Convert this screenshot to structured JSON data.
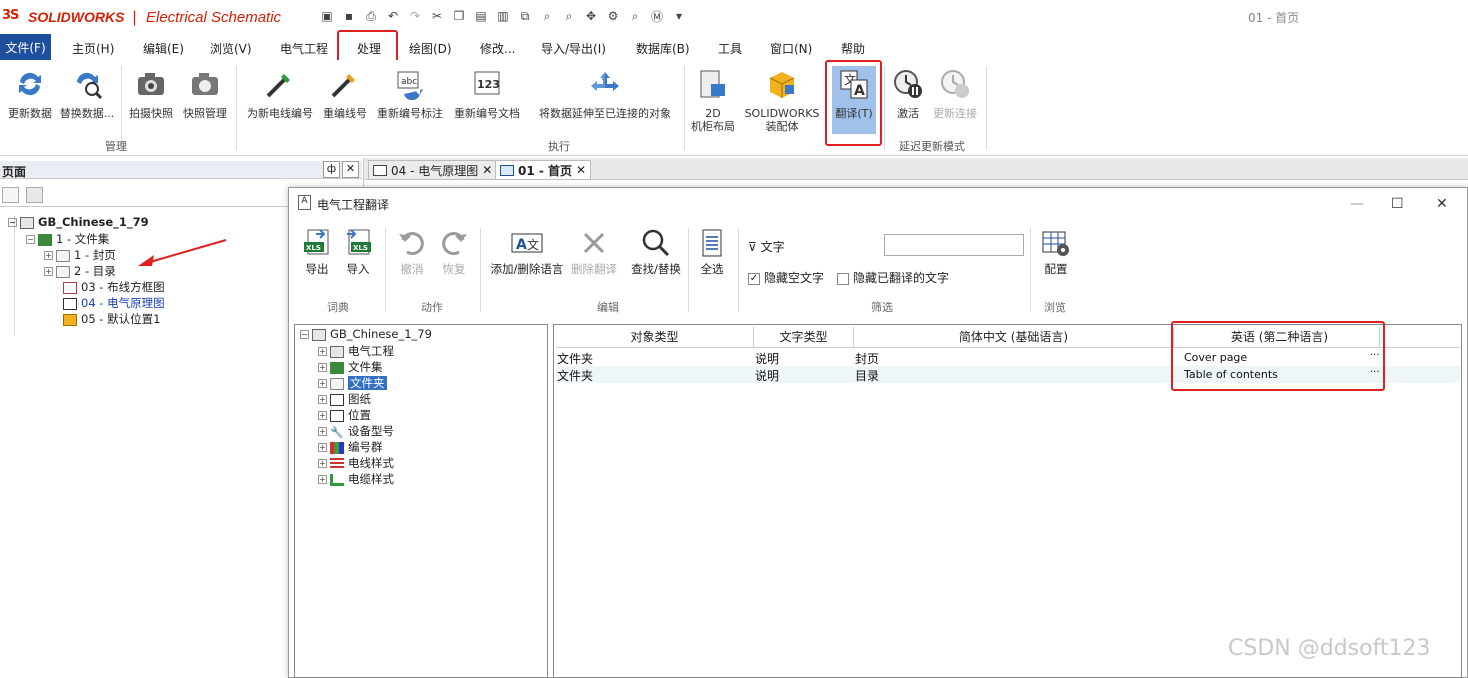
{
  "app": {
    "logo_mark": "3S",
    "brand": "SOLIDWORKS",
    "separator": "|",
    "product": "Electrical Schematic",
    "document_title": "01 - 首页"
  },
  "menu": {
    "file": "文件(F)",
    "items": [
      "主页(H)",
      "编辑(E)",
      "浏览(V)",
      "电气工程",
      "处理",
      "绘图(D)",
      "修改...",
      "导入/导出(I)",
      "数据库(B)",
      "工具",
      "窗口(N)",
      "帮助"
    ]
  },
  "ribbon": {
    "buttons": [
      "更新数据",
      "替换数据...",
      "拍摄快照",
      "快照管理",
      "为新电线编号",
      "重编线号",
      "重新编号标注",
      "重新编号文档",
      "将数据延伸至已连接的对象",
      "2D\n机柜布局",
      "SOLIDWORKS\n装配体",
      "翻译(T)",
      "激活",
      "更新连接"
    ],
    "groups": [
      "管理",
      "执行",
      "延迟更新模式"
    ]
  },
  "pages_panel": {
    "title": "页面",
    "pin": "ф",
    "close": "✕",
    "tree": [
      {
        "label": "GB_Chinese_1_79",
        "toggle": "⊟"
      },
      {
        "label": "1 - 文件集",
        "toggle": "⊟"
      },
      {
        "label": "1 - 封页",
        "toggle": "⊞"
      },
      {
        "label": "2 - 目录",
        "toggle": "⊞"
      },
      {
        "label": "03 - 布线方框图",
        "toggle": ""
      },
      {
        "label": "04 - 电气原理图",
        "toggle": ""
      },
      {
        "label": "05 - 默认位置1",
        "toggle": ""
      }
    ]
  },
  "doc_tabs": [
    {
      "label": "04 - 电气原理图",
      "close": "✕"
    },
    {
      "label": "01 - 首页",
      "close": "✕"
    }
  ],
  "dialog": {
    "title": "电气工程翻译",
    "buttons": [
      "导出",
      "导入",
      "撤消",
      "恢复",
      "添加/删除语言",
      "删除翻译",
      "查找/替换",
      "全选",
      "配置"
    ],
    "groups": [
      "词典",
      "动作",
      "编辑",
      "筛选",
      "浏览"
    ],
    "filter": {
      "label": "文字",
      "value": "",
      "hide_empty": "隐藏空文字",
      "hide_translated": "隐藏已翻译的文字",
      "hide_empty_checked": true,
      "hide_translated_checked": false
    },
    "tree": [
      "GB_Chinese_1_79",
      "电气工程",
      "文件集",
      "文件夹",
      "图纸",
      "位置",
      "设备型号",
      "编号群",
      "电线样式",
      "电缆样式"
    ],
    "grid": {
      "headers": [
        "对象类型",
        "文字类型",
        "简体中文 (基础语言)",
        "英语 (第二种语言)"
      ],
      "rows": [
        {
          "obj": "文件夹",
          "type": "说明",
          "zh": "封页",
          "en": "Cover page"
        },
        {
          "obj": "文件夹",
          "type": "说明",
          "zh": "目录",
          "en": "Table of contents"
        }
      ]
    }
  },
  "watermark": "CSDN @ddsoft123",
  "colors": {
    "brand_red": "#d81e05",
    "file_menu": "#1e4f9c",
    "highlight": "#e02020",
    "selected": "#3370c4"
  }
}
